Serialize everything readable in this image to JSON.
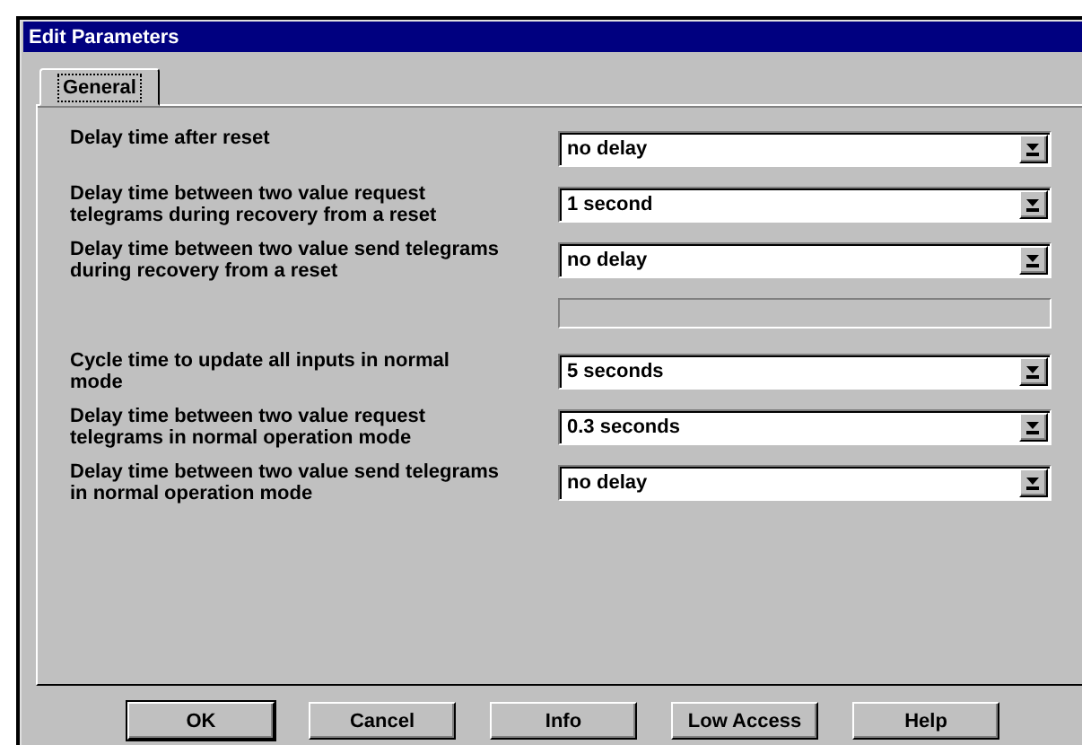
{
  "window": {
    "title": "Edit Parameters"
  },
  "tabs": [
    {
      "label": "General",
      "selected": true
    }
  ],
  "parameters": [
    {
      "kind": "dropdown",
      "label": "Delay time after reset",
      "value": "no delay"
    },
    {
      "kind": "dropdown",
      "label": "Delay time between two value request telegrams during recovery from a reset",
      "value": "1 second"
    },
    {
      "kind": "dropdown",
      "label": "Delay time between two value send telegrams during recovery from a reset",
      "value": "no delay"
    },
    {
      "kind": "blank-field",
      "disabled": true
    },
    {
      "kind": "dropdown",
      "label": "Cycle time to update all inputs in normal mode",
      "value": "5 seconds"
    },
    {
      "kind": "dropdown",
      "label": "Delay time between two value request telegrams in normal operation mode",
      "value": "0.3 seconds"
    },
    {
      "kind": "dropdown",
      "label": "Delay time between two value send telegrams  in normal operation mode",
      "value": "no delay"
    }
  ],
  "buttons": [
    {
      "label": "OK",
      "default": true
    },
    {
      "label": "Cancel",
      "default": false
    },
    {
      "label": "Info",
      "default": false
    },
    {
      "label": "Low Access",
      "default": false
    },
    {
      "label": "Help",
      "default": false
    }
  ]
}
